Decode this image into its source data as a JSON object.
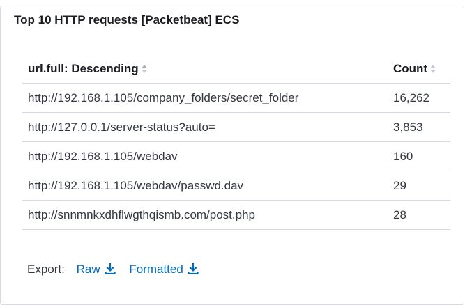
{
  "panel": {
    "title": "Top 10 HTTP requests [Packetbeat] ECS"
  },
  "table": {
    "columns": [
      {
        "label": "url.full: Descending",
        "sort_icon": "sort-arrows-icon"
      },
      {
        "label": "Count",
        "sort_icon": "sort-arrows-icon"
      }
    ],
    "rows": [
      {
        "url": "http://192.168.1.105/company_folders/secret_folder",
        "count": "16,262"
      },
      {
        "url": "http://127.0.0.1/server-status?auto=",
        "count": "3,853"
      },
      {
        "url": "http://192.168.1.105/webdav",
        "count": "160"
      },
      {
        "url": "http://192.168.1.105/webdav/passwd.dav",
        "count": "29"
      },
      {
        "url": "http://snnmnkxdhflwgthqismb.com/post.php",
        "count": "28"
      }
    ]
  },
  "export": {
    "label": "Export:",
    "raw_label": "Raw",
    "formatted_label": "Formatted",
    "icon": "download-icon"
  },
  "colors": {
    "link": "#006bb8",
    "border": "#d3dae6",
    "sort_icon": "#a2abba"
  }
}
